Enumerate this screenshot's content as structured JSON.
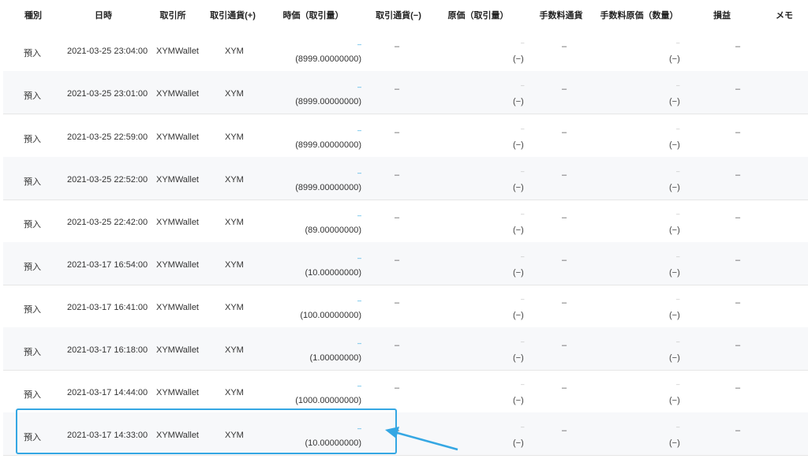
{
  "table": {
    "headers": {
      "type": "種別",
      "datetime": "日時",
      "exchange": "取引所",
      "currency_plus": "取引通貨(+)",
      "price_qty": "時価（取引量）",
      "currency_minus": "取引通貨(−)",
      "cost_qty": "原価（取引量）",
      "fee_currency": "手数料通貨",
      "fee_cost_qty": "手数料原価（数量）",
      "profit_loss": "損益",
      "memo": "メモ"
    },
    "rows": [
      {
        "type": "預入",
        "datetime": "2021-03-25 23:04:00",
        "exchange": "XYMWallet",
        "currency": "XYM",
        "price": "–",
        "qty": "(8999.00000000)",
        "minus": "–",
        "cost": "–",
        "cost_qty": "(−)",
        "fee_currency": "–",
        "fee_cost": "–",
        "fee_cost_qty": "(−)",
        "profit_loss": "–"
      },
      {
        "type": "預入",
        "datetime": "2021-03-25 23:01:00",
        "exchange": "XYMWallet",
        "currency": "XYM",
        "price": "–",
        "qty": "(8999.00000000)",
        "minus": "–",
        "cost": "–",
        "cost_qty": "(−)",
        "fee_currency": "–",
        "fee_cost": "–",
        "fee_cost_qty": "(−)",
        "profit_loss": "–"
      },
      {
        "type": "預入",
        "datetime": "2021-03-25 22:59:00",
        "exchange": "XYMWallet",
        "currency": "XYM",
        "price": "–",
        "qty": "(8999.00000000)",
        "minus": "–",
        "cost": "–",
        "cost_qty": "(−)",
        "fee_currency": "–",
        "fee_cost": "–",
        "fee_cost_qty": "(−)",
        "profit_loss": "–"
      },
      {
        "type": "預入",
        "datetime": "2021-03-25 22:52:00",
        "exchange": "XYMWallet",
        "currency": "XYM",
        "price": "–",
        "qty": "(8999.00000000)",
        "minus": "–",
        "cost": "–",
        "cost_qty": "(−)",
        "fee_currency": "–",
        "fee_cost": "–",
        "fee_cost_qty": "(−)",
        "profit_loss": "–"
      },
      {
        "type": "預入",
        "datetime": "2021-03-25 22:42:00",
        "exchange": "XYMWallet",
        "currency": "XYM",
        "price": "–",
        "qty": "(89.00000000)",
        "minus": "–",
        "cost": "–",
        "cost_qty": "(−)",
        "fee_currency": "–",
        "fee_cost": "–",
        "fee_cost_qty": "(−)",
        "profit_loss": "–"
      },
      {
        "type": "預入",
        "datetime": "2021-03-17 16:54:00",
        "exchange": "XYMWallet",
        "currency": "XYM",
        "price": "–",
        "qty": "(10.00000000)",
        "minus": "–",
        "cost": "–",
        "cost_qty": "(−)",
        "fee_currency": "–",
        "fee_cost": "–",
        "fee_cost_qty": "(−)",
        "profit_loss": "–"
      },
      {
        "type": "預入",
        "datetime": "2021-03-17 16:41:00",
        "exchange": "XYMWallet",
        "currency": "XYM",
        "price": "–",
        "qty": "(100.00000000)",
        "minus": "–",
        "cost": "–",
        "cost_qty": "(−)",
        "fee_currency": "–",
        "fee_cost": "–",
        "fee_cost_qty": "(−)",
        "profit_loss": "–"
      },
      {
        "type": "預入",
        "datetime": "2021-03-17 16:18:00",
        "exchange": "XYMWallet",
        "currency": "XYM",
        "price": "–",
        "qty": "(1.00000000)",
        "minus": "–",
        "cost": "–",
        "cost_qty": "(−)",
        "fee_currency": "–",
        "fee_cost": "–",
        "fee_cost_qty": "(−)",
        "profit_loss": "–"
      },
      {
        "type": "預入",
        "datetime": "2021-03-17 14:44:00",
        "exchange": "XYMWallet",
        "currency": "XYM",
        "price": "–",
        "qty": "(1000.00000000)",
        "minus": "–",
        "cost": "–",
        "cost_qty": "(−)",
        "fee_currency": "–",
        "fee_cost": "–",
        "fee_cost_qty": "(−)",
        "profit_loss": "–"
      },
      {
        "type": "預入",
        "datetime": "2021-03-17 14:33:00",
        "exchange": "XYMWallet",
        "currency": "XYM",
        "price": "–",
        "qty": "(10.00000000)",
        "minus": "–",
        "cost": "–",
        "cost_qty": "(−)",
        "fee_currency": "–",
        "fee_cost": "–",
        "fee_cost_qty": "(−)",
        "profit_loss": "–"
      }
    ]
  },
  "annotation": {
    "color": "#35a7e3",
    "highlighted_row": "2021-03-17 14:33:00"
  }
}
